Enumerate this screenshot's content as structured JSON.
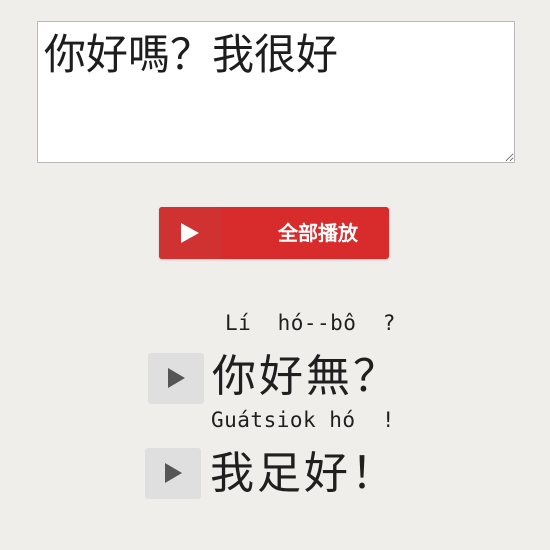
{
  "input": {
    "value": "你好嗎？我很好"
  },
  "play_all": {
    "label": "全部播放",
    "icon": "play-icon"
  },
  "sentences": [
    {
      "romanization": "Lí  hó--bô  ?",
      "characters": "你好無？"
    },
    {
      "romanization": "Guátsiok hó  !",
      "characters": "我足好！"
    }
  ]
}
